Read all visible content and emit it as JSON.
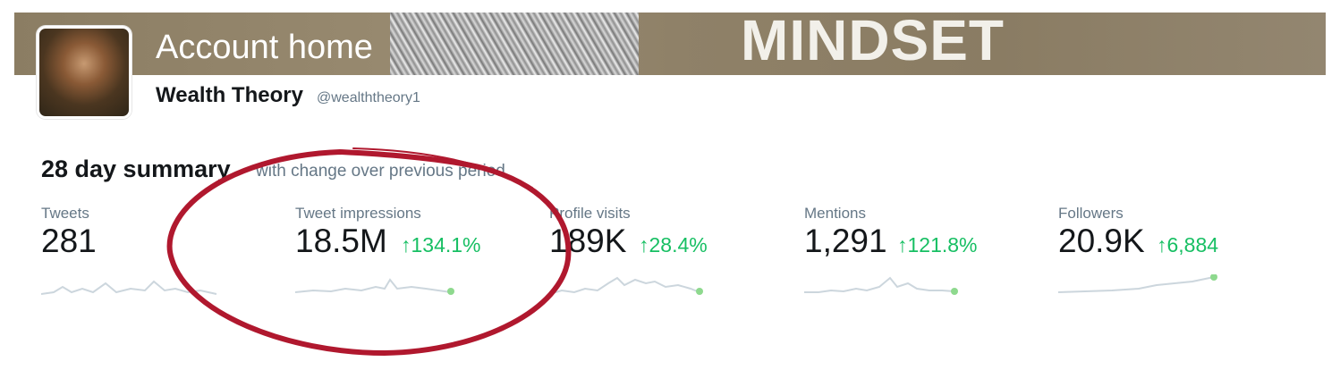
{
  "header": {
    "title": "Account home",
    "banner_text": "MINDSET",
    "account_name": "Wealth Theory",
    "account_handle": "@wealththeory1"
  },
  "summary": {
    "title": "28 day summary",
    "subtitle": "with change over previous period"
  },
  "metrics": [
    {
      "label": "Tweets",
      "value": "281",
      "change": ""
    },
    {
      "label": "Tweet impressions",
      "value": "18.5M",
      "change": "134.1%"
    },
    {
      "label": "Profile visits",
      "value": "189K",
      "change": "28.4%"
    },
    {
      "label": "Mentions",
      "value": "1,291",
      "change": "121.8%"
    },
    {
      "label": "Followers",
      "value": "20.9K",
      "change": "6,884"
    }
  ],
  "colors": {
    "positive": "#17bf63",
    "sparkline": "#ccd6dd",
    "sparkline_dot": "#8ed98e",
    "annotation_red": "#b0182e"
  },
  "icons": {
    "up_arrow": "up-arrow-icon"
  }
}
